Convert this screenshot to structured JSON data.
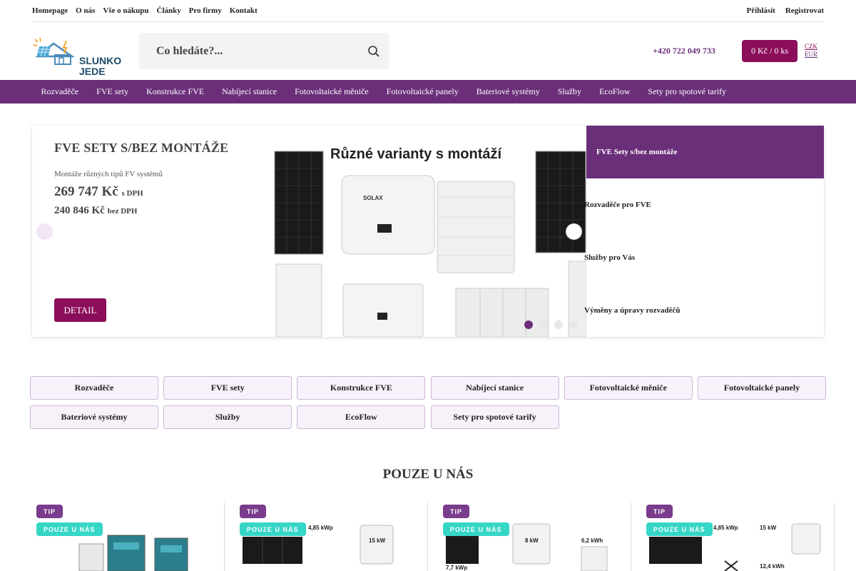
{
  "topnav": [
    "Homepage",
    "O nás",
    "Vše o nákupu",
    "Články",
    "Pro firmy",
    "Kontakt"
  ],
  "account": {
    "login": "Přihlásit",
    "register": "Registrovat"
  },
  "logo": {
    "line1": "SLUNKO",
    "line2": "JEDE"
  },
  "search": {
    "placeholder": "Co hledáte?..."
  },
  "phone": "+420 722 049 733",
  "cart": "0 Kč / 0 ks",
  "currency": {
    "czk": "CZK",
    "eur": "EUR"
  },
  "categories": [
    "Rozvaděče",
    "FVE sety",
    "Konstrukce FVE",
    "Nabíjecí stanice",
    "Fotovoltaické měniče",
    "Fotovoltaické panely",
    "Bateriové systémy",
    "Služby",
    "EcoFlow",
    "Sety pro spotové tarify"
  ],
  "hero": {
    "title": "FVE SETY S/BEZ MONTÁŽE",
    "subtitle": "Montáže různých tipů FV systémů",
    "price_vat": "269 747 Kč",
    "price_vat_label": "s DPH",
    "price_novat": "240 846 Kč",
    "price_novat_label": "bez DPH",
    "detail": "DETAIL",
    "image_title": "Různé varianty s montáží",
    "image_brand": "SOLAX",
    "side_items": [
      "FVE Sety s/bez montáže",
      "Rozvaděče pro FVE",
      "Služby pro Vás",
      "Výměny a úpravy rozvaděčů"
    ],
    "active_slide": 1,
    "slide_count": 4
  },
  "section_title": "POUZE U NÁS",
  "products": [
    {
      "tip": "TIP",
      "only": "POUZE U NÁS",
      "labels": []
    },
    {
      "tip": "TIP",
      "only": "POUZE U NÁS",
      "labels": [
        "4,85 kWp",
        "15 kW"
      ]
    },
    {
      "tip": "TIP",
      "only": "POUZE U NÁS",
      "labels": [
        "8 kW",
        "6,2 kWh",
        "7,7 kWp"
      ]
    },
    {
      "tip": "TIP",
      "only": "POUZE U NÁS",
      "labels": [
        "4,85 kWp",
        "15 kW",
        "12,4 kWh"
      ]
    }
  ],
  "colors": {
    "primary": "#6b2f7a",
    "accent": "#8b0e5a",
    "teal": "#36d6c7"
  }
}
